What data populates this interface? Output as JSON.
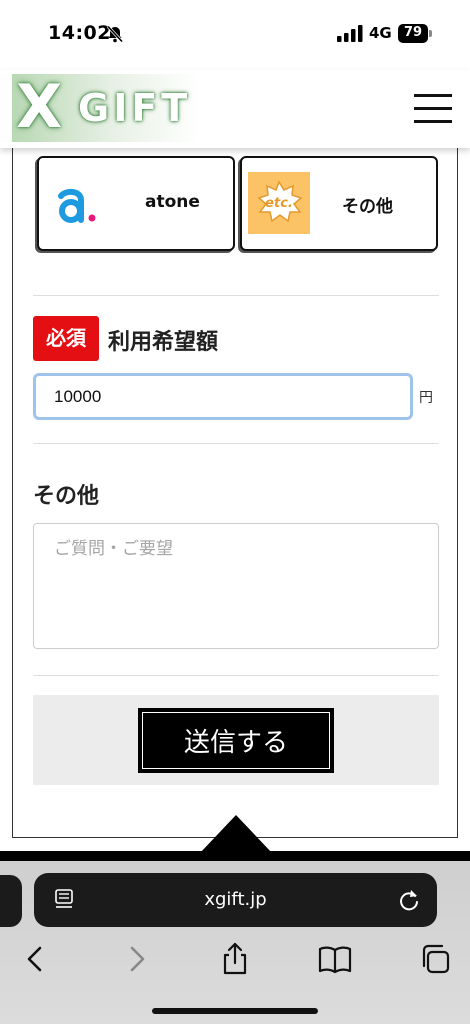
{
  "status_bar": {
    "time": "14:02",
    "network": "4G",
    "battery": "79"
  },
  "header": {
    "logo_mark": "X",
    "logo_text": "GIFT",
    "icons": {
      "menu": "hamburger-icon"
    }
  },
  "payment_options": [
    {
      "label": "atone",
      "icon": "atone-logo-icon"
    },
    {
      "label": "その他",
      "icon": "etc-icon",
      "icon_text": "etc."
    }
  ],
  "amount_field": {
    "badge": "必須",
    "label": "利用希望額",
    "value": "10000",
    "unit": "円"
  },
  "other_field": {
    "label": "その他",
    "placeholder": "ご質問・ご要望"
  },
  "submit": {
    "label": "送信する"
  },
  "browser": {
    "url": "xgift.jp",
    "icons": [
      "back-icon",
      "forward-icon",
      "share-icon",
      "bookmarks-icon",
      "tabs-icon"
    ]
  },
  "colors": {
    "required_badge": "#e40f12",
    "input_focus": "#9fc3ea",
    "etc_bg": "#fbc266",
    "atone_blue": "#1e9be0",
    "atone_pink": "#e6177a"
  }
}
